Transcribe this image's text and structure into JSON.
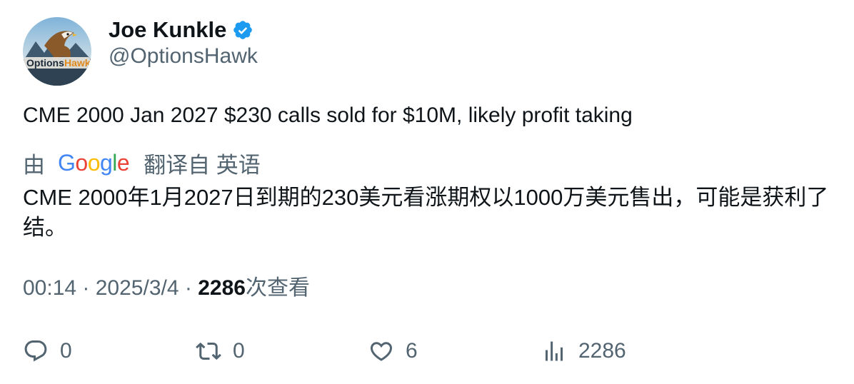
{
  "author": {
    "display_name": "Joe Kunkle",
    "handle": "@OptionsHawk",
    "verified": true,
    "avatar_text": "OptionsHawk",
    "avatar_text_a": "Options",
    "avatar_text_b": "Hawk"
  },
  "tweet": {
    "text": "CME 2000 Jan 2027 $230 calls sold for $10M, likely profit taking"
  },
  "translation": {
    "prefix": "由",
    "provider": "Google",
    "suffix": "翻译自 英语",
    "text": "CME 2000年1月2027日到期的230美元看涨期权以1000万美元售出，可能是获利了结。"
  },
  "meta": {
    "time": "00:14",
    "separator": " · ",
    "date": "2025/3/4",
    "views_count": "2286",
    "views_label": "次查看"
  },
  "actions": {
    "reply": {
      "icon": "reply-icon",
      "count": "0"
    },
    "retweet": {
      "icon": "retweet-icon",
      "count": "0"
    },
    "like": {
      "icon": "heart-icon",
      "count": "6"
    },
    "views": {
      "icon": "analytics-icon",
      "count": "2286"
    }
  },
  "colors": {
    "text_primary": "#0f1419",
    "text_secondary": "#536471",
    "verified_blue": "#1d9bf0"
  }
}
